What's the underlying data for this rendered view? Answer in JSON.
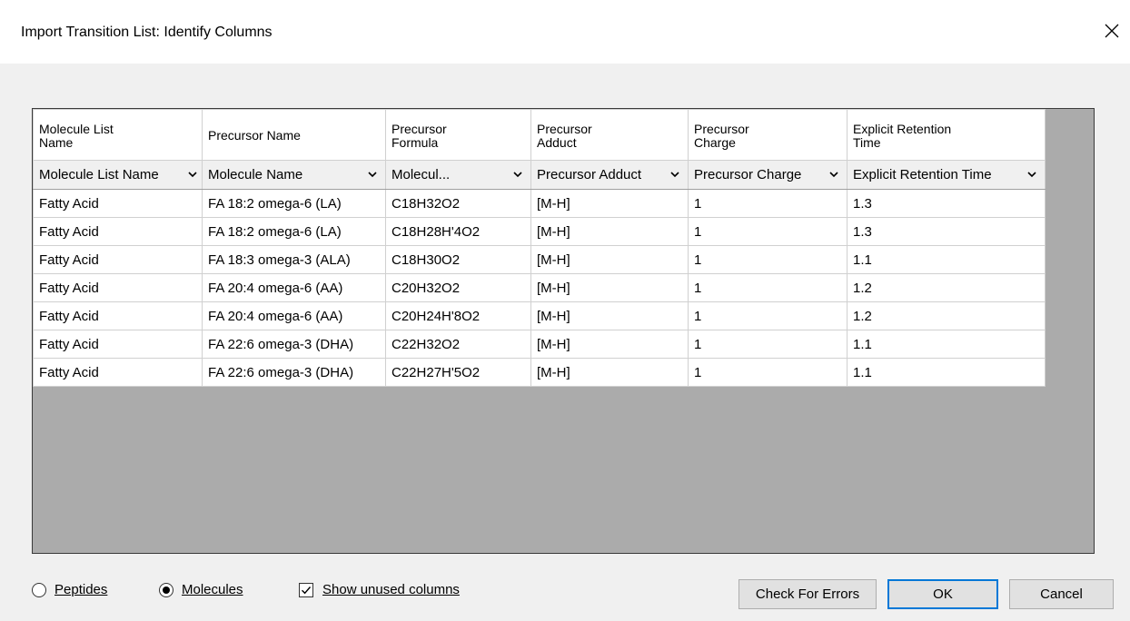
{
  "window": {
    "title": "Import Transition List: Identify Columns"
  },
  "grid": {
    "headers": [
      "Molecule List Name",
      "Precursor Name",
      "Precursor Formula",
      "Precursor Adduct",
      "Precursor Charge",
      "Explicit Retention Time"
    ],
    "header_lines": [
      [
        "Molecule List",
        "Name"
      ],
      [
        "Precursor Name",
        ""
      ],
      [
        "Precursor",
        "Formula"
      ],
      [
        "Precursor",
        "Adduct"
      ],
      [
        "Precursor",
        "Charge"
      ],
      [
        "Explicit Retention",
        "Time"
      ]
    ],
    "selectors": [
      "Molecule List Name",
      "Molecule Name",
      "Molecul...",
      "Precursor Adduct",
      "Precursor Charge",
      "Explicit Retention Time"
    ],
    "rows": [
      [
        "Fatty Acid",
        "FA 18:2 omega-6 (LA)",
        "C18H32O2",
        "[M-H]",
        "1",
        "1.3"
      ],
      [
        "Fatty Acid",
        "FA 18:2 omega-6 (LA)",
        "C18H28H'4O2",
        "[M-H]",
        "1",
        "1.3"
      ],
      [
        "Fatty Acid",
        "FA 18:3 omega-3 (ALA)",
        "C18H30O2",
        "[M-H]",
        "1",
        "1.1"
      ],
      [
        "Fatty Acid",
        "FA 20:4 omega-6 (AA)",
        "C20H32O2",
        "[M-H]",
        "1",
        "1.2"
      ],
      [
        "Fatty Acid",
        "FA 20:4 omega-6 (AA)",
        "C20H24H'8O2",
        "[M-H]",
        "1",
        "1.2"
      ],
      [
        "Fatty Acid",
        "FA 22:6 omega-3 (DHA)",
        "C22H32O2",
        "[M-H]",
        "1",
        "1.1"
      ],
      [
        "Fatty Acid",
        "FA 22:6 omega-3 (DHA)",
        "C22H27H'5O2",
        "[M-H]",
        "1",
        "1.1"
      ]
    ]
  },
  "footer": {
    "radio_peptides": {
      "label": "Peptides",
      "selected": false
    },
    "radio_molecules": {
      "label": "Molecules",
      "selected": true
    },
    "show_unused": {
      "label": "Show unused columns",
      "checked": true
    },
    "buttons": {
      "check_errors": "Check For Errors",
      "ok": "OK",
      "cancel": "Cancel"
    }
  },
  "colors": {
    "grid_background": "#ababab",
    "default_button_border": "#0078d7"
  }
}
